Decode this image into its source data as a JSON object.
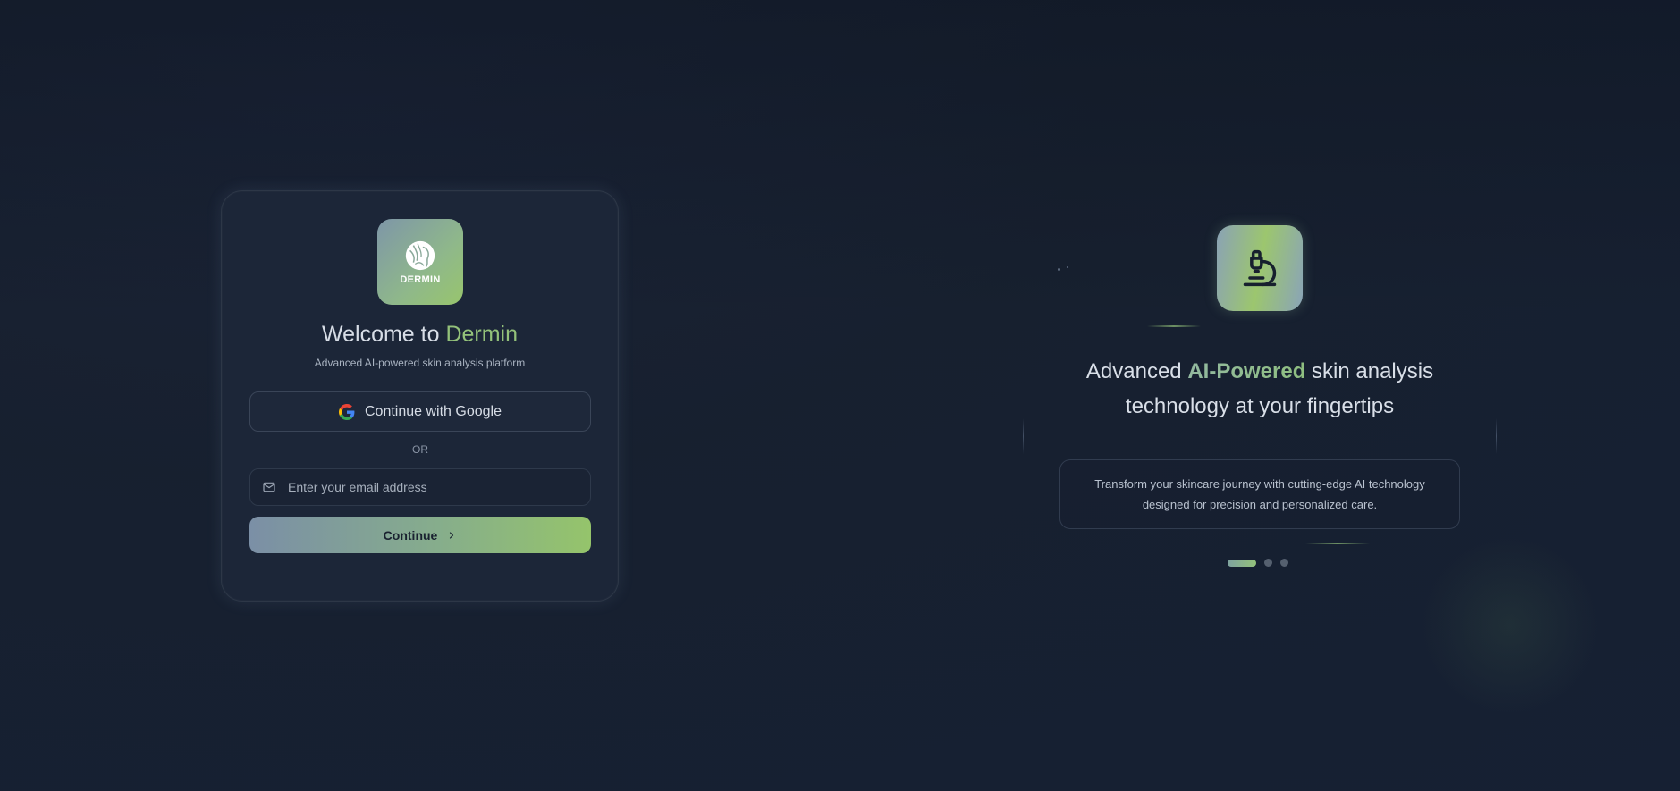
{
  "brand": {
    "logo_text": "DERMIN",
    "accent_color": "#93c17a"
  },
  "login": {
    "welcome_prefix": "Welcome to ",
    "welcome_brand": "Dermin",
    "subtitle": "Advanced AI-powered skin analysis platform",
    "google_button_label": "Continue with Google",
    "divider_text": "OR",
    "email_placeholder": "Enter your email address",
    "continue_label": "Continue"
  },
  "hero": {
    "icon": "microscope-icon",
    "headline_prefix": "Advanced ",
    "headline_accent": "AI-Powered",
    "headline_suffix_line1": " skin analysis",
    "headline_line2": "technology at your fingertips",
    "description": "Transform your skincare journey with cutting-edge AI technology designed for precision and personalized care.",
    "carousel": {
      "total_slides": 3,
      "active_index": 0
    }
  },
  "icons": {
    "google": "google-icon",
    "email": "mail-icon",
    "continue_arrow": "chevron-right-icon",
    "logo": "dermin-leaf-head-icon"
  }
}
